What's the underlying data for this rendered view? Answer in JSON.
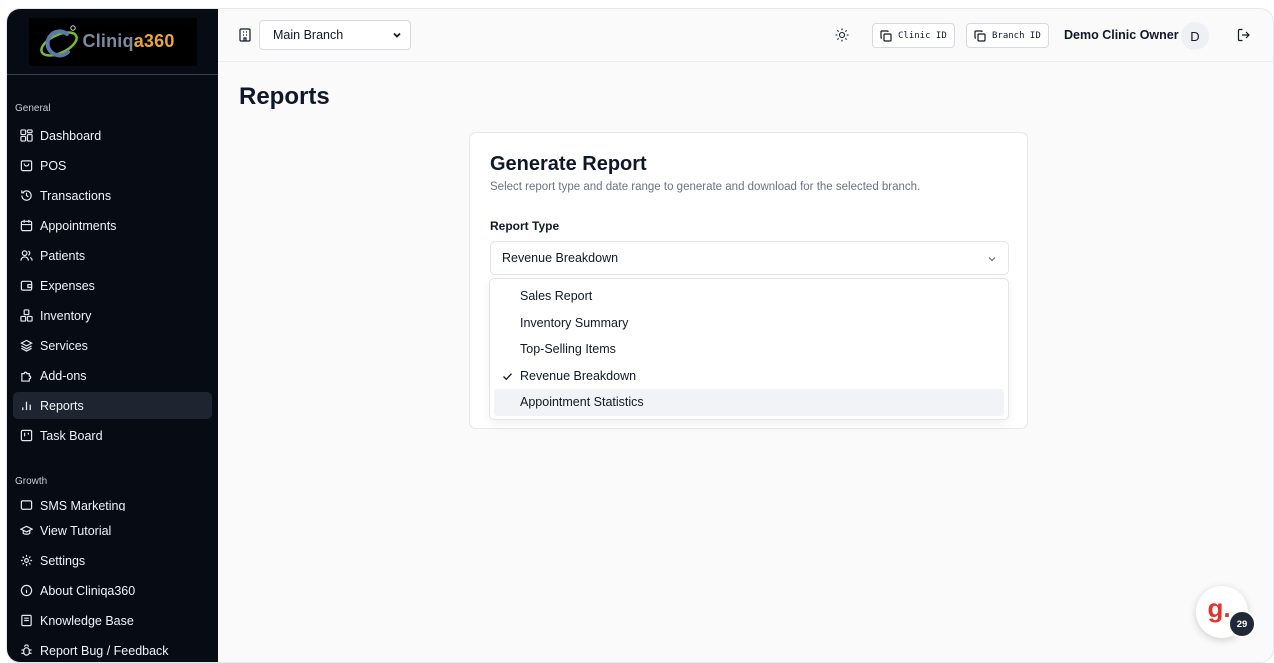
{
  "logo": {
    "text_a": "Cliniq",
    "text_b": "a360"
  },
  "sidebar": {
    "section_general": "General",
    "section_growth": "Growth",
    "items": [
      {
        "label": "Dashboard",
        "icon": "dashboard-icon"
      },
      {
        "label": "POS",
        "icon": "bag-icon"
      },
      {
        "label": "Transactions",
        "icon": "history-icon"
      },
      {
        "label": "Appointments",
        "icon": "calendar-icon"
      },
      {
        "label": "Patients",
        "icon": "users-icon"
      },
      {
        "label": "Expenses",
        "icon": "wallet-icon"
      },
      {
        "label": "Inventory",
        "icon": "boxes-icon"
      },
      {
        "label": "Services",
        "icon": "layers-icon"
      },
      {
        "label": "Add-ons",
        "icon": "puzzle-icon"
      },
      {
        "label": "Reports",
        "icon": "bar-chart-icon",
        "active": true
      },
      {
        "label": "Task Board",
        "icon": "kanban-icon"
      }
    ],
    "growth_items": [
      {
        "label": "SMS Marketing",
        "icon": "message-icon"
      }
    ],
    "bottom_items": [
      {
        "label": "View Tutorial",
        "icon": "graduation-cap-icon"
      },
      {
        "label": "Settings",
        "icon": "gear-icon"
      },
      {
        "label": "About Cliniqa360",
        "icon": "info-icon"
      },
      {
        "label": "Knowledge Base",
        "icon": "book-icon"
      },
      {
        "label": "Report Bug / Feedback",
        "icon": "bug-icon"
      }
    ]
  },
  "header": {
    "branch_value": "Main Branch",
    "clinic_id_label": "Clinic ID",
    "branch_id_label": "Branch ID",
    "owner_name": "Demo Clinic Owner",
    "avatar_initial": "D"
  },
  "main": {
    "title": "Reports",
    "card": {
      "title": "Generate Report",
      "subtitle": "Select report type and date range to generate and download for the selected branch.",
      "report_type_label": "Report Type",
      "selected": "Revenue Breakdown",
      "options": [
        "Sales Report",
        "Inventory Summary",
        "Top-Selling Items",
        "Revenue Breakdown",
        "Appointment Statistics"
      ]
    }
  },
  "widget": {
    "letter": "g.",
    "badge": "29"
  },
  "colors": {
    "sidebar_bg": "#060b14",
    "accent_orange": "#e9a53a",
    "widget_red": "#e5322d"
  }
}
